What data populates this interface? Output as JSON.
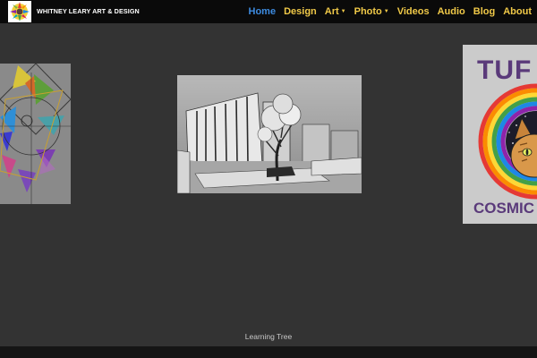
{
  "header": {
    "brand": "WHITNEY LEARY ART & DESIGN",
    "logo_icon": "sun-flower-logo-icon"
  },
  "nav": {
    "items": [
      {
        "label": "Home",
        "active": true
      },
      {
        "label": "Design"
      },
      {
        "label": "Art",
        "dropdown": true
      },
      {
        "label": "Photo",
        "dropdown": true
      },
      {
        "label": "Videos"
      },
      {
        "label": "Audio"
      },
      {
        "label": "Blog"
      },
      {
        "label": "About"
      }
    ],
    "dropdown_icon": "caret-down-icon"
  },
  "carousel": {
    "slides": [
      {
        "name": "vitruvian-geometric-artwork"
      },
      {
        "name": "learning-tree-artwork"
      },
      {
        "name": "tuff-cosmic-cat-artwork",
        "visible_text": [
          "TUF",
          "COSMIC"
        ]
      }
    ],
    "caption": "Learning Tree"
  },
  "colors": {
    "background": "#333333",
    "topbar": "#0a0a0a",
    "nav_link": "#f0c948",
    "nav_active": "#3d8be0"
  }
}
